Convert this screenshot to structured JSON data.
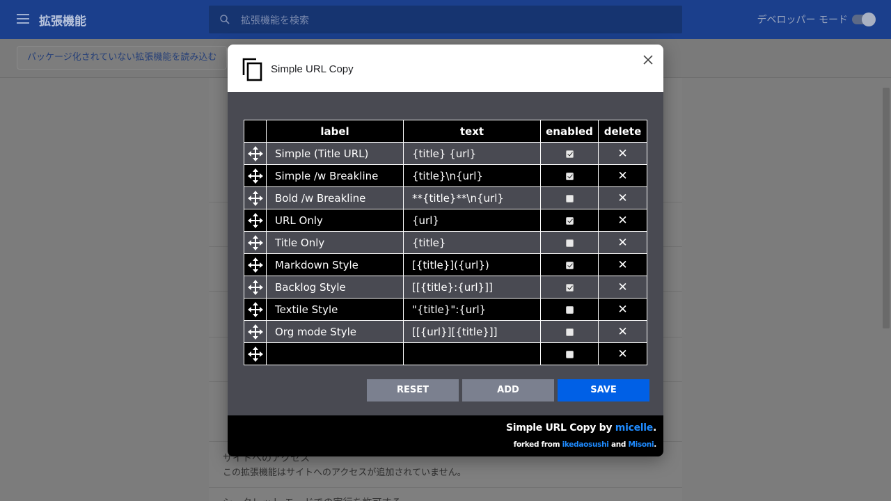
{
  "background": {
    "title": "拡張機能",
    "search_placeholder": "拡張機能を検索",
    "dev_mode_label": "デベロッパー モード",
    "load_unpacked": "パッケージ化されていない拡張機能を読み込む",
    "site_access_title": "サイトへのアクセス",
    "site_access_desc": "この拡張機能はサイトへのアクセスが追加されていません。",
    "incognito_label": "シークレット モードでの実行を許可する"
  },
  "dialog": {
    "title": "Simple URL Copy",
    "columns": [
      "label",
      "text",
      "enabled",
      "delete"
    ],
    "rows": [
      {
        "label": "Simple (Title URL)",
        "text": "{title} {url}",
        "enabled": true
      },
      {
        "label": "Simple /w Breakline",
        "text": "{title}\\n{url}",
        "enabled": true
      },
      {
        "label": "Bold /w Breakline",
        "text": "**{title}**\\n{url}",
        "enabled": false
      },
      {
        "label": "URL Only",
        "text": "{url}",
        "enabled": true
      },
      {
        "label": "Title Only",
        "text": "{title}",
        "enabled": false
      },
      {
        "label": "Markdown Style",
        "text": "[{title}]({url})",
        "enabled": true
      },
      {
        "label": "Backlog Style",
        "text": "[[{title}:{url}]]",
        "enabled": true
      },
      {
        "label": "Textile Style",
        "text": "\"{title}\":{url}",
        "enabled": false
      },
      {
        "label": "Org mode Style",
        "text": "[[{url}][{title}]]",
        "enabled": false
      },
      {
        "label": "",
        "text": "",
        "enabled": false
      }
    ],
    "delete_glyph": "✕",
    "buttons": {
      "reset": "RESET",
      "add": "ADD",
      "save": "SAVE"
    },
    "footer": {
      "app_name": "Simple URL Copy",
      "by": "by",
      "author": "micelle",
      "forked_from": "forked from",
      "fork1": "ikedaosushi",
      "and": "and",
      "fork2": "Misoni"
    }
  },
  "colors": {
    "accent": "#0060e6",
    "link": "#1f8bff",
    "dialog_body": "#494a52"
  },
  "icons": [
    "menu-icon",
    "search-icon",
    "copy-icon",
    "close-icon",
    "drag-handle-icon",
    "delete-icon"
  ]
}
